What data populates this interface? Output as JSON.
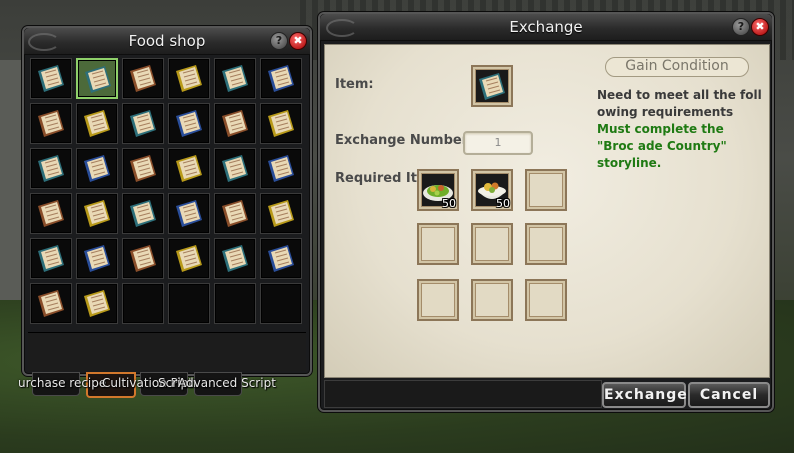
{
  "food_shop": {
    "title": "Food shop",
    "help_label": "?",
    "close_label": "✖",
    "items": [
      "teal",
      "teal",
      "brown",
      "gold",
      "teal",
      "blue",
      "brown",
      "gold",
      "teal",
      "blue",
      "brown",
      "gold",
      "teal",
      "blue",
      "brown",
      "gold",
      "teal",
      "blue",
      "brown",
      "gold",
      "teal",
      "blue",
      "brown",
      "gold",
      "teal",
      "blue",
      "brown",
      "gold",
      "teal",
      "blue",
      "brown",
      "gold",
      "",
      "",
      "",
      ""
    ],
    "selected_index": 1,
    "tabs": [
      "urchase recipe",
      "Cultivation Plan",
      "Script",
      "Advanced Script"
    ]
  },
  "exchange": {
    "title": "Exchange",
    "help_label": "?",
    "close_label": "✖",
    "item_label": "Item:",
    "exchange_number_label": "Exchange Number",
    "exchange_number_value": "1",
    "required_items_label": "Required Ite",
    "required_items": [
      {
        "icon": "salad-dish-icon",
        "qty": "50"
      },
      {
        "icon": "rice-bowl-icon",
        "qty": "50"
      }
    ],
    "gain_condition_title": "Gain Condition",
    "requirement_text": "Need to meet all the foll owing requirements",
    "condition_text": "Must complete the \"Broc ade Country\" storyline.",
    "exchange_button": "Exchange",
    "cancel_button": "Cancel"
  },
  "colors": {
    "book_teal": "#2d6f7a",
    "book_blue": "#2a4e9a",
    "book_brown": "#8a4e2a",
    "book_gold": "#b89a1a",
    "condition_green": "#1f7a13",
    "active_tab": "#d3782c"
  }
}
